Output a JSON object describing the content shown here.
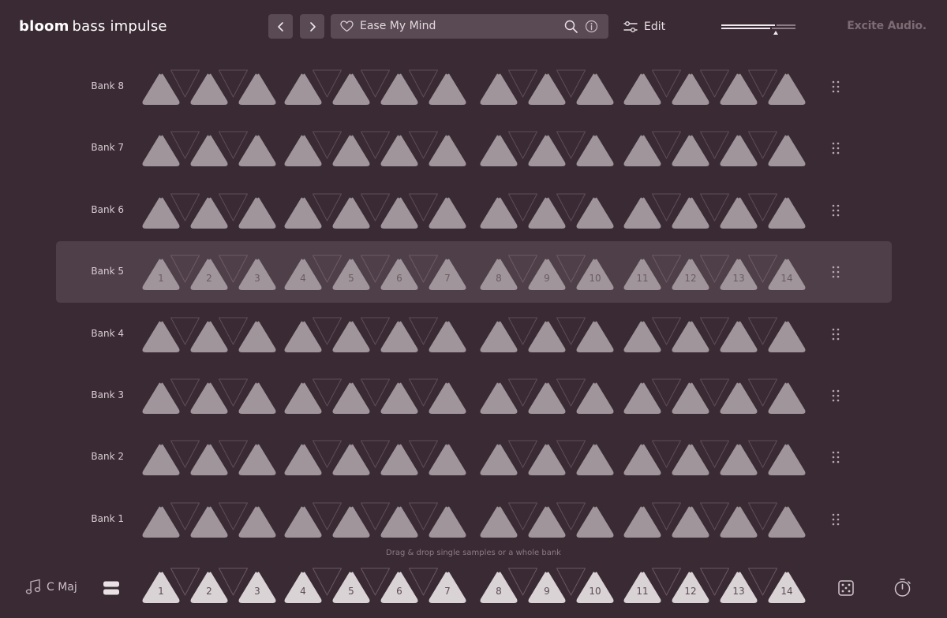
{
  "header": {
    "brand": "bloom",
    "product": "bass impulse",
    "preset_name": "Ease My Mind",
    "edit_label": "Edit",
    "company": "Excite Audio."
  },
  "banks": [
    {
      "label": "Bank 8",
      "active": false
    },
    {
      "label": "Bank 7",
      "active": false
    },
    {
      "label": "Bank 6",
      "active": false
    },
    {
      "label": "Bank 5",
      "active": true
    },
    {
      "label": "Bank 4",
      "active": false
    },
    {
      "label": "Bank 3",
      "active": false
    },
    {
      "label": "Bank 2",
      "active": false
    },
    {
      "label": "Bank 1",
      "active": false
    }
  ],
  "pad_numbers": [
    "1",
    "2",
    "3",
    "4",
    "5",
    "6",
    "7",
    "8",
    "9",
    "10",
    "11",
    "12",
    "13",
    "14"
  ],
  "hint": "Drag & drop single samples or a whole bank",
  "footer": {
    "key_label": "C Maj"
  },
  "colors": {
    "background": "#3a2a33",
    "active_row": "#4f3f48",
    "pad_up": "#a0959b",
    "pad_down_outline": "#5f4e58",
    "footer_pad": "#d9d3d6"
  },
  "icons": {
    "prev": "chevron-left-icon",
    "next": "chevron-right-icon",
    "favorite": "heart-icon",
    "search": "search-icon",
    "info": "info-icon",
    "edit": "sliders-icon",
    "drag": "drag-handle-icon",
    "key": "music-note-icon",
    "layers": "layers-icon",
    "randomize": "dice-icon",
    "timer": "timer-icon"
  }
}
